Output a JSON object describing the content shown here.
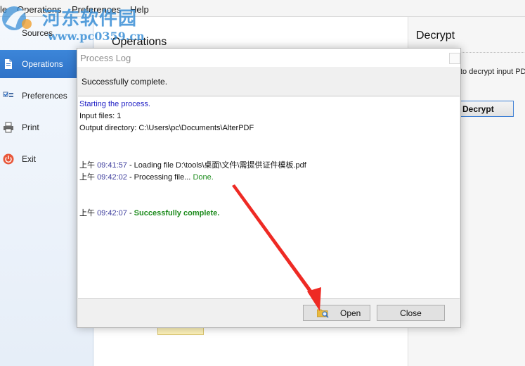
{
  "menu": {
    "items": [
      "le",
      "Operations",
      "Preferences",
      "Help"
    ]
  },
  "watermark": {
    "title": "河东软件园",
    "url": "www.pc0359.cn"
  },
  "sidebar": {
    "sources_label": "Sources",
    "items": [
      {
        "label": "Operations",
        "icon": "document-icon",
        "active": true
      },
      {
        "label": "Preferences",
        "icon": "checklist-icon",
        "active": false
      },
      {
        "label": "Print",
        "icon": "printer-icon",
        "active": false
      },
      {
        "label": "Exit",
        "icon": "power-icon",
        "active": false
      }
    ]
  },
  "main": {
    "heading": "Operations"
  },
  "right_panel": {
    "title": "Decrypt",
    "text": "to decrypt input PD",
    "button_label": "Decrypt"
  },
  "dialog": {
    "title": "Process Log",
    "status": "Successfully complete.",
    "log": {
      "starting": "Starting the process.",
      "input_files": "Input files: 1",
      "output_dir": "Output directory: C:\\Users\\pc\\Documents\\AlterPDF",
      "line1_prefix": "上午 ",
      "line1_time": "09:41:57",
      "line1_text": " - Loading file D:\\tools\\桌面\\文件\\需提供证件模板.pdf",
      "line2_prefix": "上午 ",
      "line2_time": "09:42:02",
      "line2_text": " - Processing file... ",
      "line2_done": "Done.",
      "line3_prefix": "上午 ",
      "line3_time": "09:42:07",
      "line3_dash": " - ",
      "line3_success": "Successfully complete."
    },
    "open_label": "Open",
    "close_label": "Close"
  },
  "colors": {
    "accent": "#2f72c7",
    "annotation_arrow": "#ee2a24",
    "log_blue": "#1d1dc4",
    "log_green": "#1e8c1e"
  }
}
